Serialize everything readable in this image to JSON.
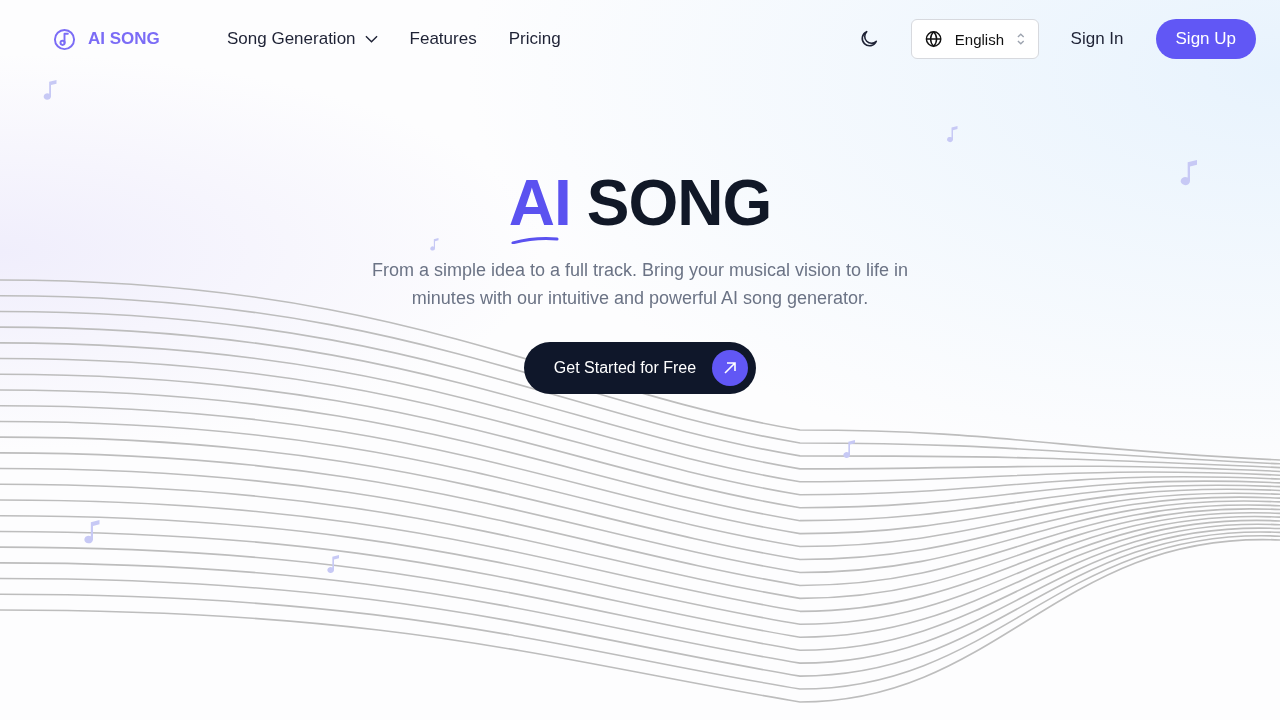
{
  "header": {
    "logo_text": "AI SONG",
    "nav": [
      {
        "label": "Song Generation",
        "has_dropdown": true
      },
      {
        "label": "Features",
        "has_dropdown": false
      },
      {
        "label": "Pricing",
        "has_dropdown": false
      }
    ],
    "language": "English",
    "sign_in": "Sign In",
    "sign_up": "Sign Up"
  },
  "hero": {
    "title_accent": "AI",
    "title_main": "SONG",
    "subtitle": "From a simple idea to a full track. Bring your musical vision to life in minutes with our intuitive and powerful AI song generator.",
    "cta": "Get Started for Free"
  }
}
